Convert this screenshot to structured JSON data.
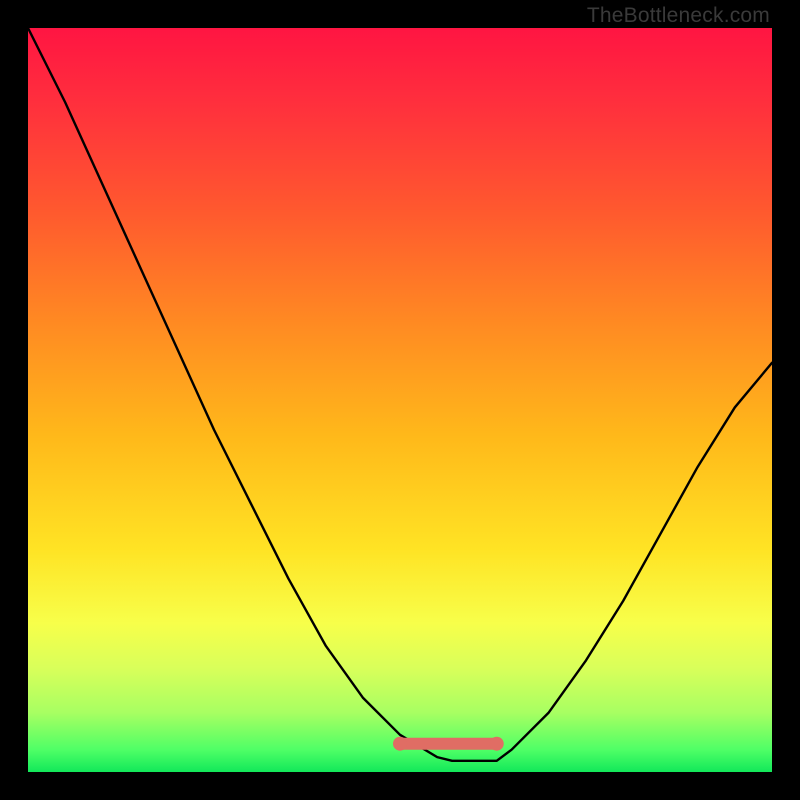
{
  "attribution": "TheBottleneck.com",
  "chart_data": {
    "type": "line",
    "title": "",
    "xlabel": "",
    "ylabel": "",
    "xlim": [
      0,
      100
    ],
    "ylim": [
      0,
      100
    ],
    "grid": false,
    "legend": false,
    "background_gradient": {
      "direction": "vertical",
      "stops": [
        {
          "pos": 0,
          "color": "#ff1542"
        },
        {
          "pos": 25,
          "color": "#ff5a2e"
        },
        {
          "pos": 55,
          "color": "#ffb91a"
        },
        {
          "pos": 80,
          "color": "#f7ff4a"
        },
        {
          "pos": 100,
          "color": "#12e85a"
        }
      ]
    },
    "series": [
      {
        "name": "bottleneck-curve",
        "stroke": "#000000",
        "x": [
          0,
          5,
          10,
          15,
          20,
          25,
          30,
          35,
          40,
          45,
          50,
          55,
          57,
          60,
          63,
          65,
          70,
          75,
          80,
          85,
          90,
          95,
          100
        ],
        "values": [
          100,
          90,
          79,
          68,
          57,
          46,
          36,
          26,
          17,
          10,
          5,
          2,
          1.5,
          1.5,
          1.5,
          3,
          8,
          15,
          23,
          32,
          41,
          49,
          55
        ]
      }
    ],
    "annotations": [
      {
        "name": "flat-minimum-highlight",
        "type": "segment",
        "stroke": "#e06d64",
        "x0": 50,
        "y0": 3.8,
        "x1": 63,
        "y1": 3.8
      }
    ]
  }
}
